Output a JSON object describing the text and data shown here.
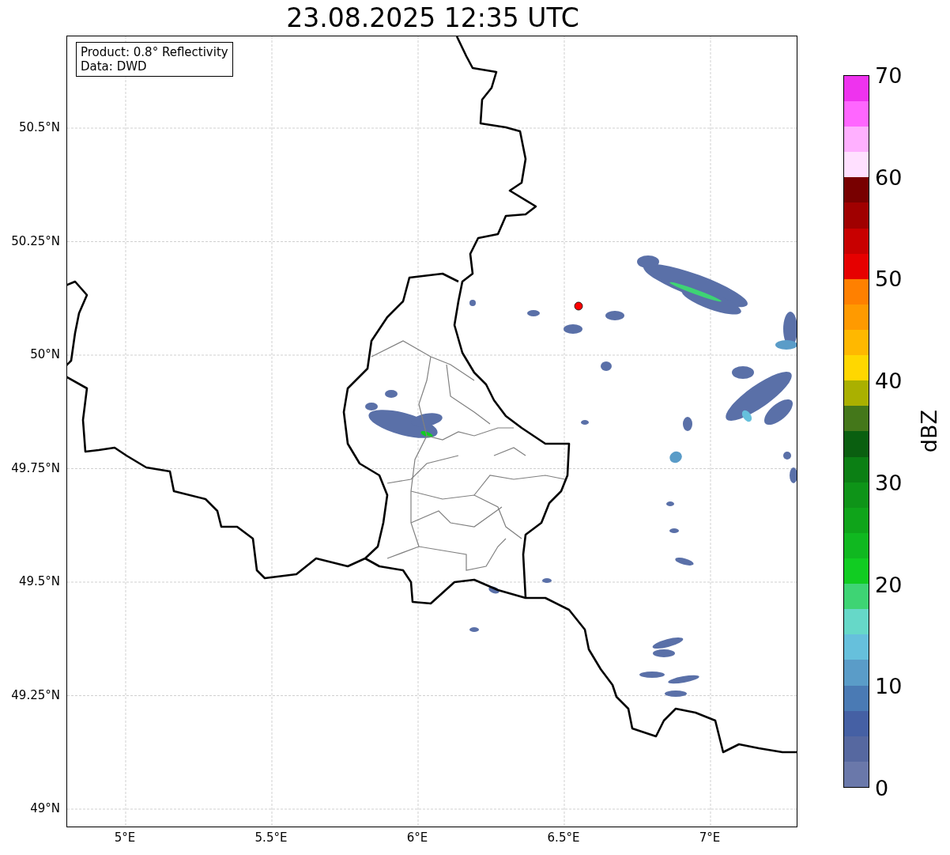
{
  "title": "23.08.2025 12:35 UTC",
  "info_box": [
    "Product: 0.8° Reflectivity",
    "Data: DWD"
  ],
  "lat_ticks": [
    "50.5°N",
    "50.25°N",
    "50°N",
    "49.75°N",
    "49.5°N",
    "49.25°N",
    "49°N"
  ],
  "lon_ticks": [
    "5°E",
    "5.5°E",
    "6°E",
    "6.5°E",
    "7°E"
  ],
  "colorbar": {
    "label": "dBZ",
    "ticks": [
      "70",
      "60",
      "50",
      "40",
      "30",
      "20",
      "10",
      "0"
    ],
    "segments": [
      {
        "color": "#6a78aa"
      },
      {
        "color": "#5668a0"
      },
      {
        "color": "#4560a4"
      },
      {
        "color": "#4a7ab4"
      },
      {
        "color": "#5a9cc8"
      },
      {
        "color": "#66c0dc"
      },
      {
        "color": "#66d8c8"
      },
      {
        "color": "#3ed474"
      },
      {
        "color": "#11cc22"
      },
      {
        "color": "#10b820"
      },
      {
        "color": "#0fa41a"
      },
      {
        "color": "#0e9418"
      },
      {
        "color": "#0b7f14"
      },
      {
        "color": "#0a5f10"
      },
      {
        "color": "#44771a"
      },
      {
        "color": "#aab000"
      },
      {
        "color": "#ffd700"
      },
      {
        "color": "#ffb800"
      },
      {
        "color": "#ff9a00"
      },
      {
        "color": "#ff8000"
      },
      {
        "color": "#e60000"
      },
      {
        "color": "#c80000"
      },
      {
        "color": "#a00000"
      },
      {
        "color": "#780000"
      },
      {
        "color": "#ffe0ff"
      },
      {
        "color": "#ffb0ff"
      },
      {
        "color": "#ff66ff"
      },
      {
        "color": "#ee33ee"
      }
    ]
  }
}
